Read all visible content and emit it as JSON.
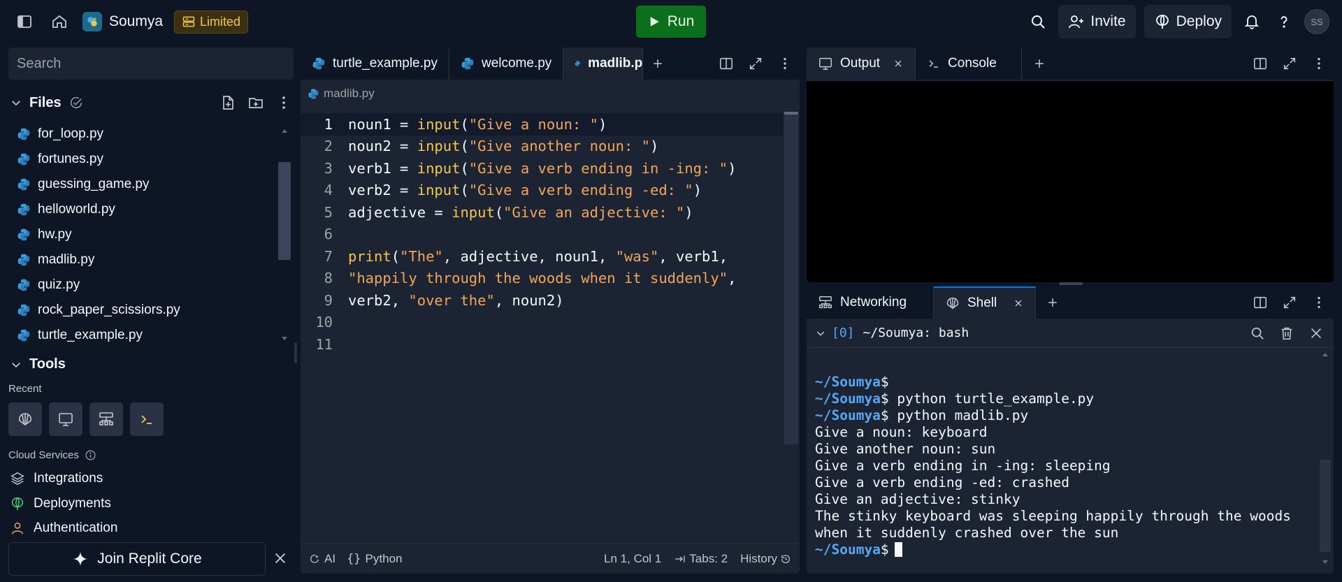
{
  "topbar": {
    "repl_name": "Soumya",
    "plan_badge": "Limited",
    "run_label": "Run",
    "invite_label": "Invite",
    "deploy_label": "Deploy",
    "avatar_initials": "SS"
  },
  "left": {
    "search_placeholder": "Search",
    "files_title": "Files",
    "files": [
      "for_loop.py",
      "fortunes.py",
      "guessing_game.py",
      "helloworld.py",
      "hw.py",
      "madlib.py",
      "quiz.py",
      "rock_paper_scissiors.py",
      "turtle_example.py"
    ],
    "tools_title": "Tools",
    "recent_label": "Recent",
    "cloud_label": "Cloud Services",
    "services": [
      "Integrations",
      "Deployments",
      "Authentication"
    ],
    "join_label": "Join Replit Core"
  },
  "editor": {
    "tabs": [
      "turtle_example.py",
      "welcome.py",
      "madlib.p"
    ],
    "breadcrumb": "madlib.py",
    "status_ai": "AI",
    "status_lang": "Python",
    "status_pos": "Ln 1, Col 1",
    "status_tabs": "Tabs: 2",
    "status_history": "History"
  },
  "code_lines": [
    {
      "n": "1",
      "parts": [
        [
          "w",
          "noun1 = "
        ],
        [
          "y",
          "input"
        ],
        [
          "w",
          "("
        ],
        [
          "s",
          "\"Give a noun: \""
        ],
        [
          "w",
          ")"
        ]
      ]
    },
    {
      "n": "2",
      "parts": [
        [
          "w",
          "noun2 = "
        ],
        [
          "y",
          "input"
        ],
        [
          "w",
          "("
        ],
        [
          "s",
          "\"Give another noun: \""
        ],
        [
          "w",
          ")"
        ]
      ]
    },
    {
      "n": "3",
      "parts": [
        [
          "w",
          "verb1 = "
        ],
        [
          "y",
          "input"
        ],
        [
          "w",
          "("
        ],
        [
          "s",
          "\"Give a verb ending in -ing: \""
        ],
        [
          "w",
          ")"
        ]
      ]
    },
    {
      "n": "4",
      "parts": [
        [
          "w",
          "verb2 = "
        ],
        [
          "y",
          "input"
        ],
        [
          "w",
          "("
        ],
        [
          "s",
          "\"Give a verb ending -ed: \""
        ],
        [
          "w",
          ")"
        ]
      ]
    },
    {
      "n": "5",
      "parts": [
        [
          "w",
          "adjective = "
        ],
        [
          "y",
          "input"
        ],
        [
          "w",
          "("
        ],
        [
          "s",
          "\"Give an adjective: \""
        ],
        [
          "w",
          ")"
        ]
      ]
    },
    {
      "n": "6",
      "parts": []
    },
    {
      "n": "7",
      "parts": [
        [
          "y",
          "print"
        ],
        [
          "w",
          "("
        ],
        [
          "s",
          "\"The\""
        ],
        [
          "w",
          ", adjective, noun1, "
        ],
        [
          "s",
          "\"was\""
        ],
        [
          "w",
          ", verb1,"
        ]
      ]
    },
    {
      "n": "8",
      "parts": [
        [
          "s",
          "\"happily through the woods when it suddenly\""
        ],
        [
          "w",
          ","
        ]
      ]
    },
    {
      "n": "9",
      "parts": [
        [
          "w",
          "verb2, "
        ],
        [
          "s",
          "\"over the\""
        ],
        [
          "w",
          ", noun2)"
        ]
      ]
    },
    {
      "n": "10",
      "parts": []
    },
    {
      "n": "11",
      "parts": []
    }
  ],
  "output": {
    "tabs": [
      "Output",
      "Console"
    ]
  },
  "shell": {
    "tabs": [
      "Networking",
      "Shell"
    ],
    "session_index": "[0]",
    "session_title": "~/Soumya: bash",
    "lines": [
      {
        "prompt": "~/Soumya",
        "text": "$"
      },
      {
        "prompt": "~/Soumya",
        "text": "$ python turtle_example.py"
      },
      {
        "prompt": "~/Soumya",
        "text": "$ python madlib.py"
      },
      {
        "prompt": "",
        "text": "Give a noun: keyboard"
      },
      {
        "prompt": "",
        "text": "Give another noun: sun"
      },
      {
        "prompt": "",
        "text": "Give a verb ending in -ing: sleeping"
      },
      {
        "prompt": "",
        "text": "Give a verb ending -ed: crashed"
      },
      {
        "prompt": "",
        "text": "Give an adjective: stinky"
      },
      {
        "prompt": "",
        "text": "The stinky keyboard was sleeping happily through the woods"
      },
      {
        "prompt": "",
        "text": "when it suddenly crashed over the sun"
      }
    ],
    "final_prompt": "~/Soumya",
    "final_text": "$"
  }
}
